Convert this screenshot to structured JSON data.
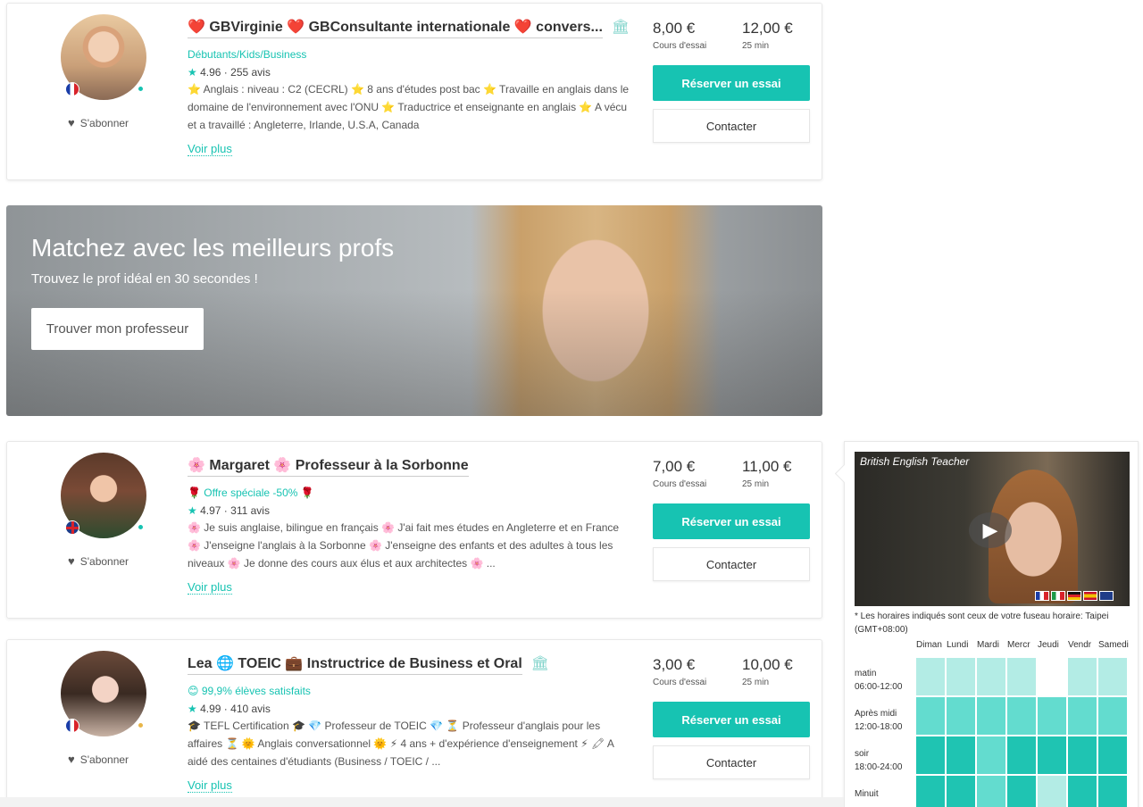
{
  "teachers": [
    {
      "title": "❤️ GBVirginie ❤️ GBConsultante internationale ❤️ convers...",
      "title_badge": "🏛",
      "flag": "fr",
      "tagline": "Débutants/Kids/Business",
      "rating": "4.96",
      "reviews": "255 avis",
      "description": "⭐ Anglais : niveau : C2 (CECRL) ⭐ 8 ans d'études post bac ⭐ Travaille en anglais dans le domaine de l'environnement avec l'ONU ⭐ Traductrice et enseignante en anglais ⭐ A vécu et a travaillé : Angleterre, Irlande, U.S.A, Canada",
      "more": "Voir plus",
      "subscribe": "S'abonner",
      "trial_price": "8,00 €",
      "trial_label": "Cours d'essai",
      "price": "12,00 €",
      "duration": "25 min",
      "book": "Réserver un essai",
      "contact": "Contacter"
    },
    {
      "title": "🌸 Margaret 🌸 Professeur à la Sorbonne",
      "title_badge": "",
      "flag": "gb",
      "tagline": "🌹 Offre spéciale -50% 🌹",
      "rating": "4.97",
      "reviews": "311 avis",
      "description": "🌸 Je suis anglaise, bilingue en français 🌸 J'ai fait mes études en Angleterre et en France 🌸 J'enseigne l'anglais à la Sorbonne 🌸 J'enseigne des enfants et des adultes à tous les niveaux 🌸 Je donne des cours aux élus et aux architectes 🌸 ...",
      "more": "Voir plus",
      "subscribe": "S'abonner",
      "trial_price": "7,00 €",
      "trial_label": "Cours d'essai",
      "price": "11,00 €",
      "duration": "25 min",
      "book": "Réserver un essai",
      "contact": "Contacter"
    },
    {
      "title": "Lea 🌐 TOEIC 💼 Instructrice de Business et Oral",
      "title_badge": "🏛",
      "flag": "fr",
      "tagline": "😊 99,9% élèves satisfaits",
      "rating": "4.99",
      "reviews": "410 avis",
      "description": "🎓 TEFL Certification 🎓 💎 Professeur de TOEIC 💎 ⏳ Professeur d'anglais pour les affaires ⏳ 🌞 Anglais conversationnel 🌞 ⚡ 4 ans + d'expérience d'enseignement ⚡ 🖍 A aidé des centaines d'étudiants (Business / TOEIC / ...",
      "more": "Voir plus",
      "subscribe": "S'abonner",
      "trial_price": "3,00 €",
      "trial_label": "Cours d'essai",
      "price": "10,00 €",
      "duration": "25 min",
      "book": "Réserver un essai",
      "contact": "Contacter"
    }
  ],
  "banner": {
    "title": "Matchez avec les meilleurs profs",
    "subtitle": "Trouvez le prof idéal en 30 secondes !",
    "button": "Trouver mon professeur"
  },
  "preview": {
    "video_title": "British English Teacher",
    "play_icon": "play-icon",
    "timezone_note": "* Les horaires indiqués sont ceux de votre fuseau horaire: Taipei (GMT+08:00)",
    "days": [
      "Diman",
      "Lundi",
      "Mardi",
      "Mercr",
      "Jeudi",
      "Vendr",
      "Samedi"
    ],
    "slots": [
      {
        "name": "matin",
        "hours": "06:00-12:00",
        "levels": [
          1,
          1,
          1,
          1,
          0,
          1,
          1
        ]
      },
      {
        "name": "Après midi",
        "hours": "12:00-18:00",
        "levels": [
          2,
          2,
          2,
          2,
          2,
          2,
          2
        ]
      },
      {
        "name": "soir",
        "hours": "18:00-24:00",
        "levels": [
          3,
          3,
          2,
          3,
          3,
          3,
          3
        ]
      },
      {
        "name": "Minuit",
        "hours": "",
        "levels": [
          3,
          3,
          2,
          3,
          1,
          3,
          3
        ]
      }
    ]
  },
  "colors": {
    "accent": "#17c3b2",
    "text": "#333333"
  }
}
